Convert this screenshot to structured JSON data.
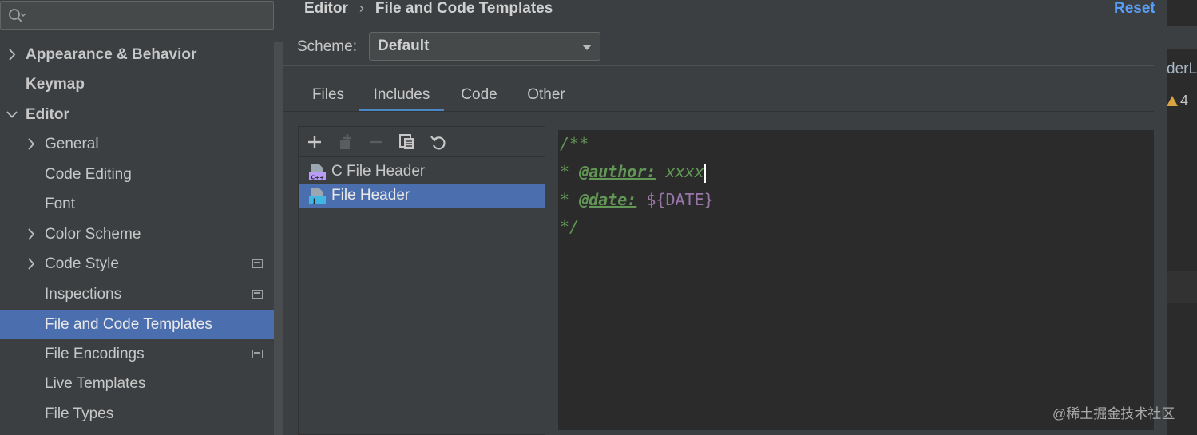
{
  "sidebar": {
    "search_placeholder": "",
    "items": [
      {
        "label": "Appearance & Behavior",
        "expandable": true,
        "expanded": false,
        "bold": true
      },
      {
        "label": "Keymap",
        "bold": true
      },
      {
        "label": "Editor",
        "expandable": true,
        "expanded": true,
        "bold": true
      },
      {
        "label": "General",
        "expandable": true
      },
      {
        "label": "Code Editing"
      },
      {
        "label": "Font"
      },
      {
        "label": "Color Scheme",
        "expandable": true
      },
      {
        "label": "Code Style",
        "expandable": true,
        "has_project_badge": true
      },
      {
        "label": "Inspections",
        "has_project_badge": true
      },
      {
        "label": "File and Code Templates",
        "selected": true
      },
      {
        "label": "File Encodings",
        "has_project_badge": true
      },
      {
        "label": "Live Templates"
      },
      {
        "label": "File Types"
      }
    ]
  },
  "header": {
    "breadcrumb": [
      "Editor",
      "File and Code Templates"
    ],
    "reset_label": "Reset"
  },
  "scheme": {
    "label": "Scheme:",
    "value": "Default"
  },
  "tabs": [
    {
      "label": "Files"
    },
    {
      "label": "Includes",
      "active": true
    },
    {
      "label": "Code"
    },
    {
      "label": "Other"
    }
  ],
  "toolbar": {
    "icons": [
      "add-icon",
      "add-child-icon",
      "remove-icon",
      "copy-icon",
      "reset-icon"
    ]
  },
  "templates": [
    {
      "label": "C File Header",
      "icon": "cpp-file-icon"
    },
    {
      "label": "File Header",
      "icon": "java-file-icon",
      "selected": true
    }
  ],
  "editor": {
    "line1": "/**",
    "line2_prefix": "* ",
    "line2_tag": "@author:",
    "line2_text": " xxxx",
    "line3_prefix": "* ",
    "line3_tag": "@date:",
    "line3_text": " ",
    "line3_var": "${DATE}",
    "line4": "*/"
  },
  "background": {
    "fragment": "derLi",
    "warning_count": "4"
  },
  "watermark": "@稀土掘金技术社区",
  "colors": {
    "accent": "#4b6eaf",
    "link": "#589df6",
    "comment": "#629755",
    "variable": "#9876aa"
  }
}
